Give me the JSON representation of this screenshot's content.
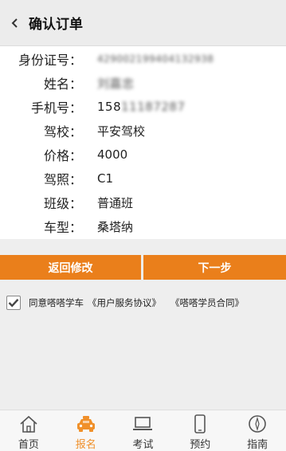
{
  "header": {
    "title": "确认订单"
  },
  "info": {
    "rows": [
      {
        "label": "身份证号：",
        "value": "429002199404132938"
      },
      {
        "label": "姓名：",
        "value": "刘嘉忠"
      },
      {
        "label": "手机号：",
        "value_visible": "158",
        "value_blurred": "11187287"
      },
      {
        "label": "驾校：",
        "value": "平安驾校"
      },
      {
        "label": "价格：",
        "value": "4000"
      },
      {
        "label": "驾照：",
        "value": "C1"
      },
      {
        "label": "班级：",
        "value": "普通班"
      },
      {
        "label": "车型：",
        "value": "桑塔纳"
      }
    ]
  },
  "actions": {
    "back_label": "返回修改",
    "next_label": "下一步"
  },
  "agreement": {
    "checked": true,
    "text": "同意嗒嗒学车",
    "link1": "《用户服务协议》",
    "link2": "《嗒嗒学员合同》"
  },
  "tabbar": {
    "active": "报名",
    "items": [
      {
        "label": "首页",
        "icon": "home-icon"
      },
      {
        "label": "报名",
        "icon": "car-icon"
      },
      {
        "label": "考试",
        "icon": "laptop-icon"
      },
      {
        "label": "预约",
        "icon": "phone-icon"
      },
      {
        "label": "指南",
        "icon": "compass-icon"
      }
    ]
  },
  "colors": {
    "accent": "#ea7f1b",
    "active_tab": "#f0902a"
  }
}
